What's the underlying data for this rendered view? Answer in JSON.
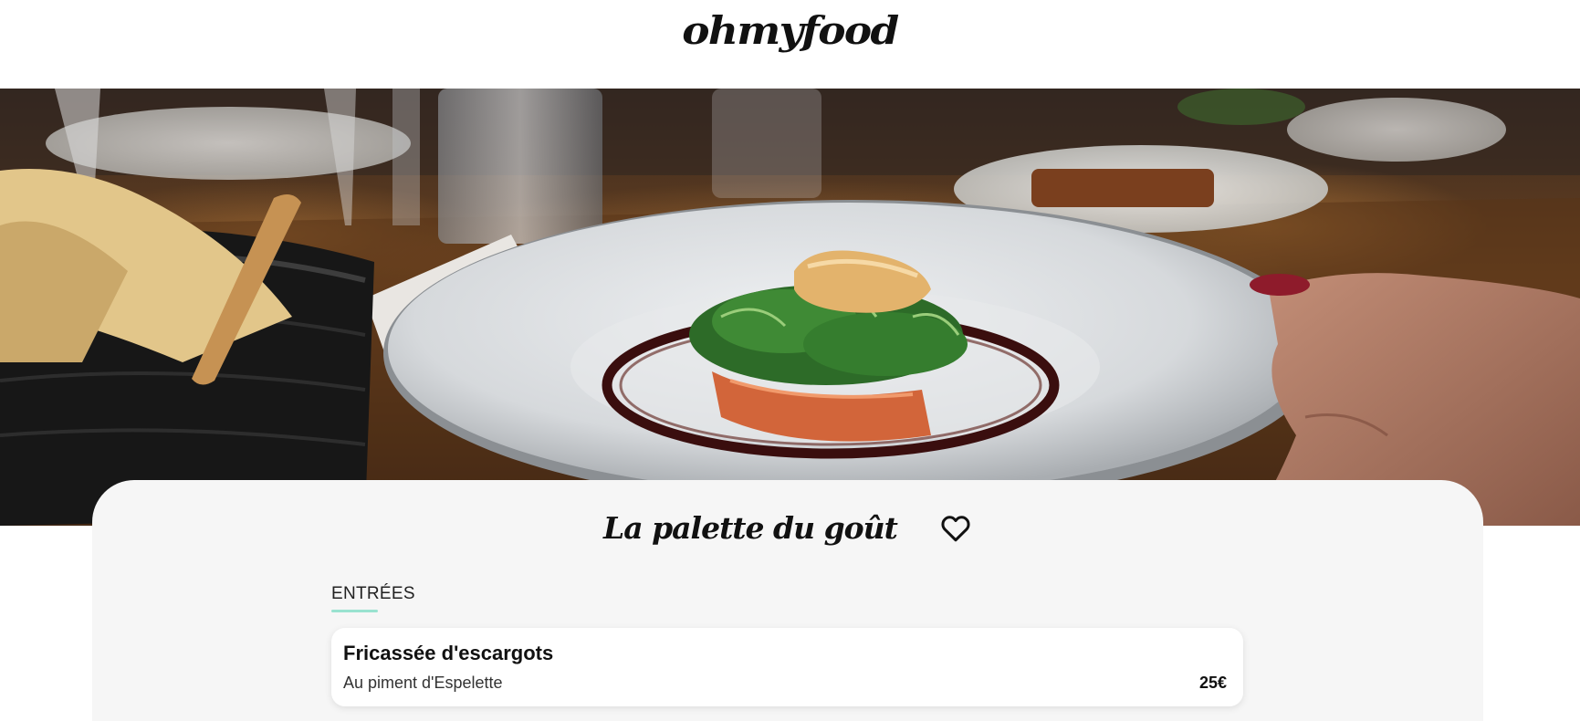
{
  "header": {
    "logo_text": "ohmyfood"
  },
  "hero": {
    "image_subject": "plated-dish-photo"
  },
  "restaurant": {
    "name": "La palette du goût",
    "like_icon": "heart-outline-icon"
  },
  "menu": {
    "sections": [
      {
        "title": "ENTRÉES",
        "accent_color": "#99e2d0",
        "dishes": [
          {
            "name": "Fricassée d'escargots",
            "description": "Au piment d'Espelette",
            "price": "25€"
          }
        ]
      }
    ]
  },
  "colors": {
    "card_background": "#f6f6f6",
    "accent": "#99e2d0",
    "text": "#111111"
  }
}
